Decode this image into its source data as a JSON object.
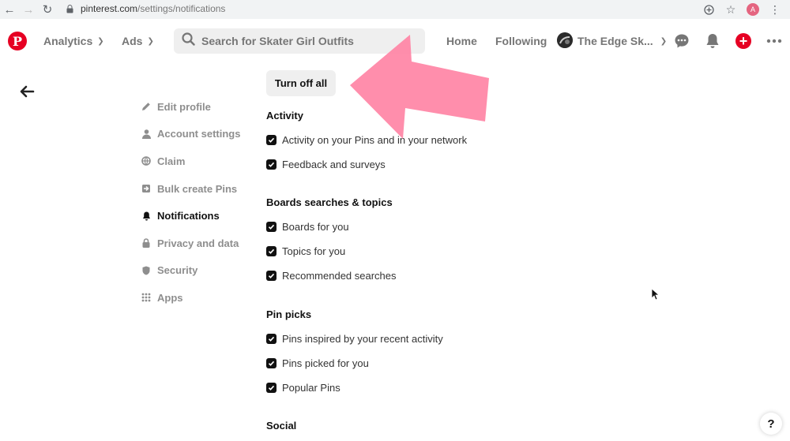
{
  "browser": {
    "url_host": "pinterest.com",
    "url_path": "/settings/notifications",
    "profile_initial": "A"
  },
  "header": {
    "nav": {
      "analytics": "Analytics",
      "ads": "Ads",
      "home": "Home",
      "following": "Following"
    },
    "search_placeholder": "Search for Skater Girl Outfits",
    "account_name": "The Edge Sk..."
  },
  "sidebar": {
    "items": [
      {
        "label": "Edit profile",
        "icon": "pencil-icon",
        "active": false
      },
      {
        "label": "Account settings",
        "icon": "person-icon",
        "active": false
      },
      {
        "label": "Claim",
        "icon": "globe-icon",
        "active": false
      },
      {
        "label": "Bulk create Pins",
        "icon": "import-icon",
        "active": false
      },
      {
        "label": "Notifications",
        "icon": "bell-icon",
        "active": true
      },
      {
        "label": "Privacy and data",
        "icon": "lock-icon",
        "active": false
      },
      {
        "label": "Security",
        "icon": "shield-icon",
        "active": false
      },
      {
        "label": "Apps",
        "icon": "grid-icon",
        "active": false
      }
    ]
  },
  "main": {
    "turn_off_all": "Turn off all",
    "sections": [
      {
        "title": "Activity",
        "options": [
          {
            "label": "Activity on your Pins and in your network",
            "checked": true
          },
          {
            "label": "Feedback and surveys",
            "checked": true
          }
        ]
      },
      {
        "title": "Boards searches & topics",
        "options": [
          {
            "label": "Boards for you",
            "checked": true
          },
          {
            "label": "Topics for you",
            "checked": true
          },
          {
            "label": "Recommended searches",
            "checked": true
          }
        ]
      },
      {
        "title": "Pin picks",
        "options": [
          {
            "label": "Pins inspired by your recent activity",
            "checked": true
          },
          {
            "label": "Pins picked for you",
            "checked": true
          },
          {
            "label": "Popular Pins",
            "checked": true
          }
        ]
      },
      {
        "title": "Social",
        "options": []
      }
    ]
  },
  "help": {
    "label": "?"
  },
  "colors": {
    "brand_red": "#e60023",
    "arrow_pink": "#ff85a6"
  }
}
